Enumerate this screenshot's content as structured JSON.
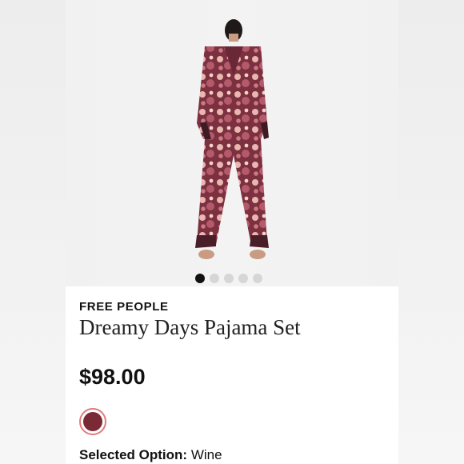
{
  "product": {
    "brand": "FREE PEOPLE",
    "title": "Dreamy Days Pajama Set",
    "price": "$98.00",
    "image_icon": "product-photo",
    "carousel": {
      "count": 5,
      "active_index": 0
    },
    "swatch": {
      "name": "Wine",
      "color": "#7a2a35",
      "ring_color": "#e07a7a"
    },
    "selected_option": {
      "label": "Selected Option:",
      "value": "Wine"
    }
  },
  "colors": {
    "fabric_dark": "#5e2430",
    "fabric_mid": "#9c4a5a",
    "fabric_light": "#e8b7b0"
  }
}
